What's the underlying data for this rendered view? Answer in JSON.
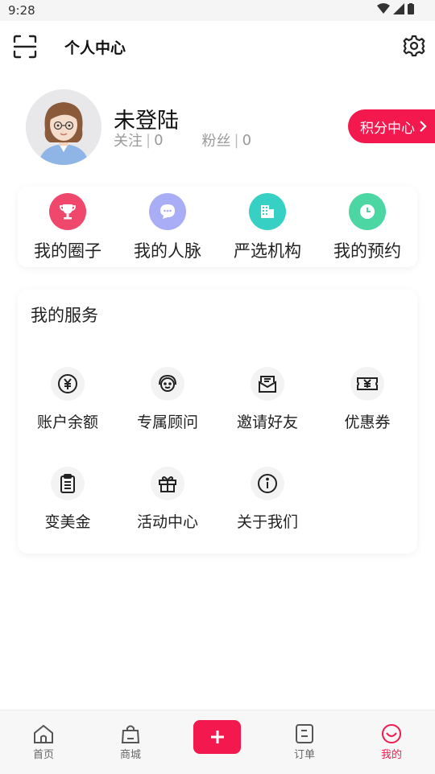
{
  "status_bar": {
    "time": "9:28"
  },
  "header": {
    "title": "个人中心"
  },
  "profile": {
    "username": "未登陆",
    "follow_label": "关注",
    "follow_count": "0",
    "fans_label": "粉丝",
    "fans_count": "0",
    "points_label": "积分中心"
  },
  "quick_actions": [
    {
      "label": "我的圈子",
      "icon": "trophy-icon",
      "color": "#f0476d"
    },
    {
      "label": "我的人脉",
      "icon": "chat-bubble-icon",
      "color": "#a9adf5"
    },
    {
      "label": "严选机构",
      "icon": "building-icon",
      "color": "#36d1c4"
    },
    {
      "label": "我的预约",
      "icon": "clock-icon",
      "color": "#4cd6a4"
    }
  ],
  "services": {
    "title": "我的服务",
    "items": [
      {
        "label": "账户余额",
        "icon": "yuan-coin-icon"
      },
      {
        "label": "专属顾问",
        "icon": "headset-icon"
      },
      {
        "label": "邀请好友",
        "icon": "envelope-icon"
      },
      {
        "label": "优惠券",
        "icon": "coupon-icon"
      },
      {
        "label": "变美金",
        "icon": "clipboard-icon"
      },
      {
        "label": "活动中心",
        "icon": "gift-icon"
      },
      {
        "label": "关于我们",
        "icon": "info-icon"
      }
    ]
  },
  "tabbar": {
    "items": [
      {
        "label": "首页",
        "icon": "home-icon"
      },
      {
        "label": "商城",
        "icon": "shopping-bag-icon"
      },
      {
        "label": "",
        "icon": "plus-icon"
      },
      {
        "label": "订单",
        "icon": "order-icon"
      },
      {
        "label": "我的",
        "icon": "smile-icon"
      }
    ],
    "active": "我的"
  },
  "colors": {
    "accent": "#f3184e"
  }
}
